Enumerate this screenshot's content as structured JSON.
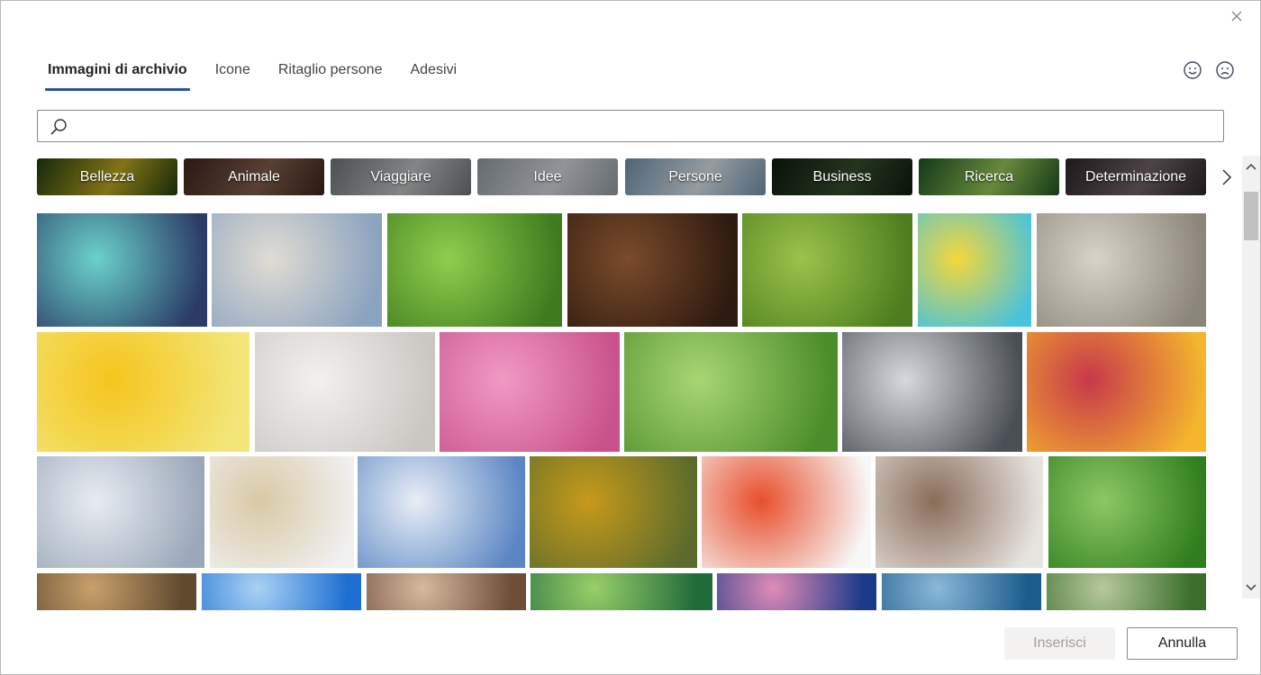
{
  "tabs": [
    {
      "label": "Immagini di archivio",
      "active": true
    },
    {
      "label": "Icone",
      "active": false
    },
    {
      "label": "Ritaglio persone",
      "active": false
    },
    {
      "label": "Adesivi",
      "active": false
    }
  ],
  "search": {
    "value": "",
    "placeholder": ""
  },
  "categories": [
    {
      "label": "Bellezza",
      "colors": [
        "#1f3a10",
        "#b6a01f"
      ]
    },
    {
      "label": "Animale",
      "colors": [
        "#3b2219",
        "#7a5a48"
      ]
    },
    {
      "label": "Viaggiare",
      "colors": [
        "#6b6f72",
        "#b5b8ba"
      ]
    },
    {
      "label": "Idee",
      "colors": [
        "#8d949b",
        "#c9ced3"
      ]
    },
    {
      "label": "Persone",
      "colors": [
        "#6d8ca6",
        "#cfd8df"
      ]
    },
    {
      "label": "Business",
      "colors": [
        "#0e1a0e",
        "#324a2a"
      ]
    },
    {
      "label": "Ricerca",
      "colors": [
        "#1f4f22",
        "#8fbf55"
      ]
    },
    {
      "label": "Determinazione",
      "colors": [
        "#2a2426",
        "#6c5e61"
      ]
    }
  ],
  "gallery_colors": [
    [
      "#2b3a66",
      "#6ad2c9"
    ],
    [
      "#8aa3bf",
      "#e0dcd3"
    ],
    [
      "#3e7b1f",
      "#8fce4c"
    ],
    [
      "#2d1a10",
      "#7b4b2a"
    ],
    [
      "#4d7d1e",
      "#9ac34a"
    ],
    [
      "#46c3dd",
      "#f5d73a"
    ],
    [
      "#8c8579",
      "#d8d2c9"
    ],
    [
      "#f2e67a",
      "#f5c51d"
    ],
    [
      "#c9c7c2",
      "#f2f1ee"
    ],
    [
      "#c9528b",
      "#f09ac2"
    ],
    [
      "#4b8d2a",
      "#a8d673"
    ],
    [
      "#4a4e55",
      "#d5d8dc"
    ],
    [
      "#f5b62e",
      "#c8384a"
    ],
    [
      "#9aa8b8",
      "#e7ecf1"
    ],
    [
      "#f0f0f0",
      "#d9c9a6"
    ],
    [
      "#5b86c4",
      "#e8eef5"
    ],
    [
      "#5c6b2c",
      "#c79a1a"
    ],
    [
      "#f7f7f7",
      "#e84f2c"
    ],
    [
      "#e7e4e0",
      "#8a6d5a"
    ],
    [
      "#2f7d1e",
      "#8dc865"
    ],
    [
      "#5f4a2e",
      "#c9a06a"
    ],
    [
      "#1e6fd1",
      "#a9d2f5"
    ],
    [
      "#6e4c36",
      "#d6b9a0"
    ],
    [
      "#1f6b3a",
      "#99cf6a"
    ],
    [
      "#1c3a8a",
      "#e28bb6"
    ],
    [
      "#1b5c8c",
      "#8ab8d8"
    ],
    [
      "#3a6e2a",
      "#b7c89d"
    ]
  ],
  "buttons": {
    "insert": "Inserisci",
    "cancel": "Annulla"
  }
}
